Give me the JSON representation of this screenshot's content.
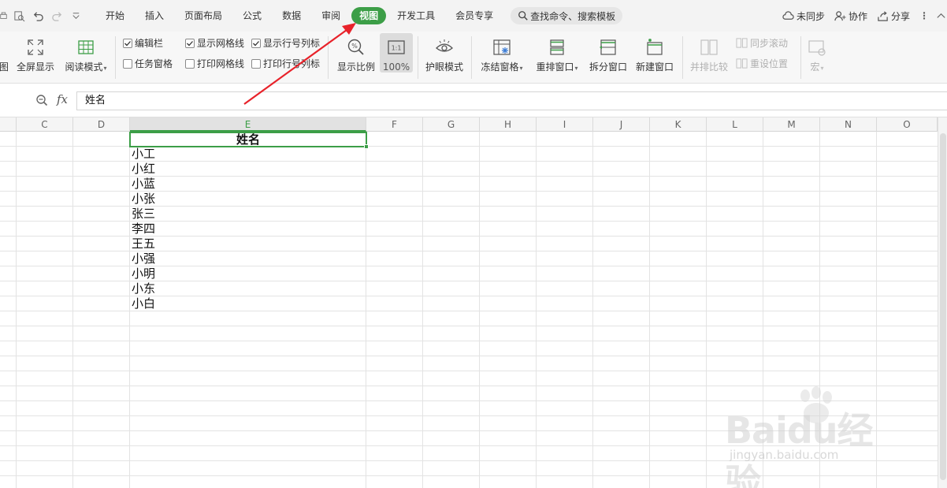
{
  "menu": {
    "tabs": [
      "开始",
      "插入",
      "页面布局",
      "公式",
      "数据",
      "审阅",
      "视图",
      "开发工具",
      "会员专享"
    ],
    "active_tab": "视图",
    "search_placeholder": "查找命令、搜索模板",
    "right": {
      "sync": "未同步",
      "collab": "协作",
      "share": "分享"
    }
  },
  "ribbon": {
    "partial_label": "图",
    "fullscreen": "全屏显示",
    "reading_mode": "阅读模式",
    "checkboxes": [
      {
        "label": "编辑栏",
        "checked": true
      },
      {
        "label": "任务窗格",
        "checked": false
      },
      {
        "label": "显示网格线",
        "checked": true
      },
      {
        "label": "打印网格线",
        "checked": false
      },
      {
        "label": "显示行号列标",
        "checked": true
      },
      {
        "label": "打印行号列标",
        "checked": false
      }
    ],
    "zoom_ratio": "显示比例",
    "zoom_100": "100%",
    "eye_mode": "护眼模式",
    "freeze": "冻结窗格",
    "arrange": "重排窗口",
    "split": "拆分窗口",
    "new_window": "新建窗口",
    "side_by_side": "并排比较",
    "sync_scroll": "同步滚动",
    "reset_position": "重设位置",
    "macro": "宏"
  },
  "formula": {
    "fx": "fx",
    "value": "姓名"
  },
  "grid": {
    "columns": [
      "",
      "C",
      "D",
      "E",
      "F",
      "G",
      "H",
      "I",
      "J",
      "K",
      "L",
      "M",
      "N",
      "O"
    ],
    "selected_column": "E",
    "header": "姓名",
    "names": [
      "小工",
      "小红",
      "小蓝",
      "小张",
      "张三",
      "李四",
      "王五",
      "小强",
      "小明",
      "小东",
      "小白"
    ]
  },
  "watermark": {
    "brand": "Baidu经验",
    "url": "jingyan.baidu.com"
  },
  "colors": {
    "accent": "#3c9e47",
    "arrow": "#e8222a"
  }
}
